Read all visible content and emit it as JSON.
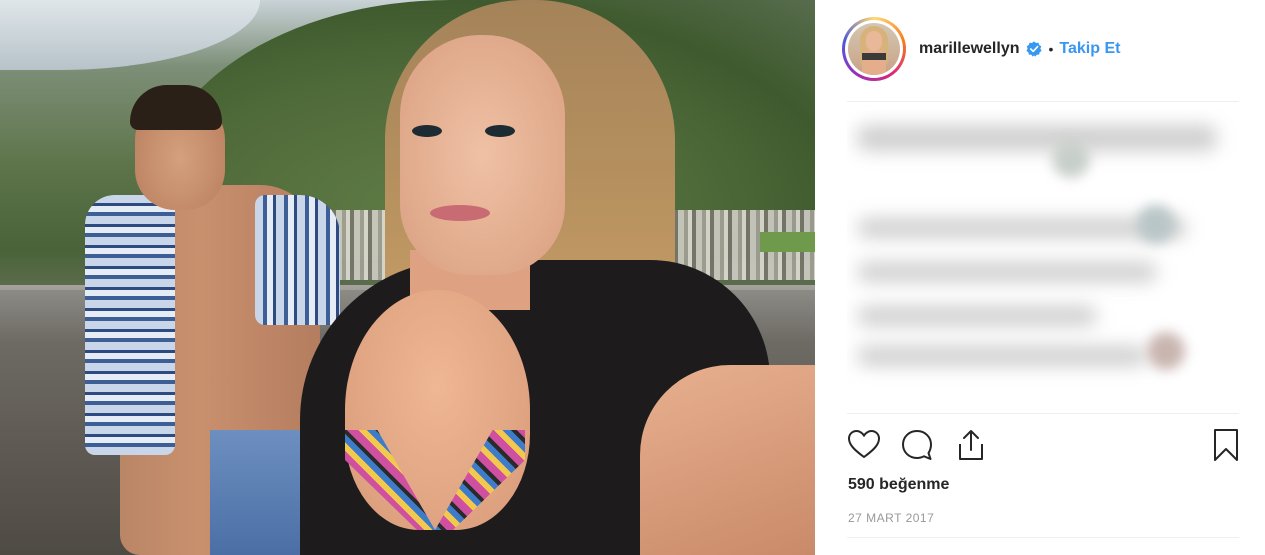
{
  "post": {
    "username": "marillewellyn",
    "verified": true,
    "separator": "•",
    "follow_label": "Takip Et",
    "likes_text": "590 beğenme",
    "date_text": "27 MART 2017"
  },
  "icons": {
    "verified": "verified-badge-icon",
    "like": "heart-icon",
    "comment": "comment-bubble-icon",
    "share": "share-upload-icon",
    "save": "bookmark-icon"
  },
  "colors": {
    "follow": "#3897f0",
    "verified": "#3897f0",
    "text": "#262626",
    "muted": "#999999",
    "divider": "#efefef"
  }
}
